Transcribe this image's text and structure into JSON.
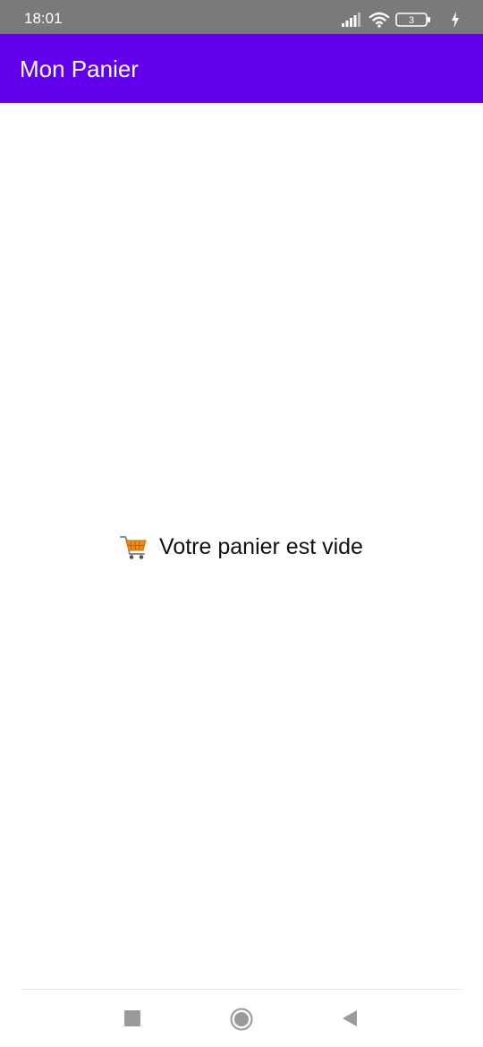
{
  "status_bar": {
    "time": "18:01",
    "battery_level": "3",
    "icons": [
      "signal-icon",
      "wifi-icon",
      "battery-icon",
      "charging-icon"
    ]
  },
  "app_bar": {
    "title": "Mon Panier",
    "color": "#6200ee"
  },
  "main": {
    "empty_icon": "shopping-cart-icon",
    "empty_message": "Votre panier est vide"
  },
  "nav_bar": {
    "icons": [
      "recents-square-icon",
      "home-circle-icon",
      "back-triangle-icon"
    ]
  }
}
